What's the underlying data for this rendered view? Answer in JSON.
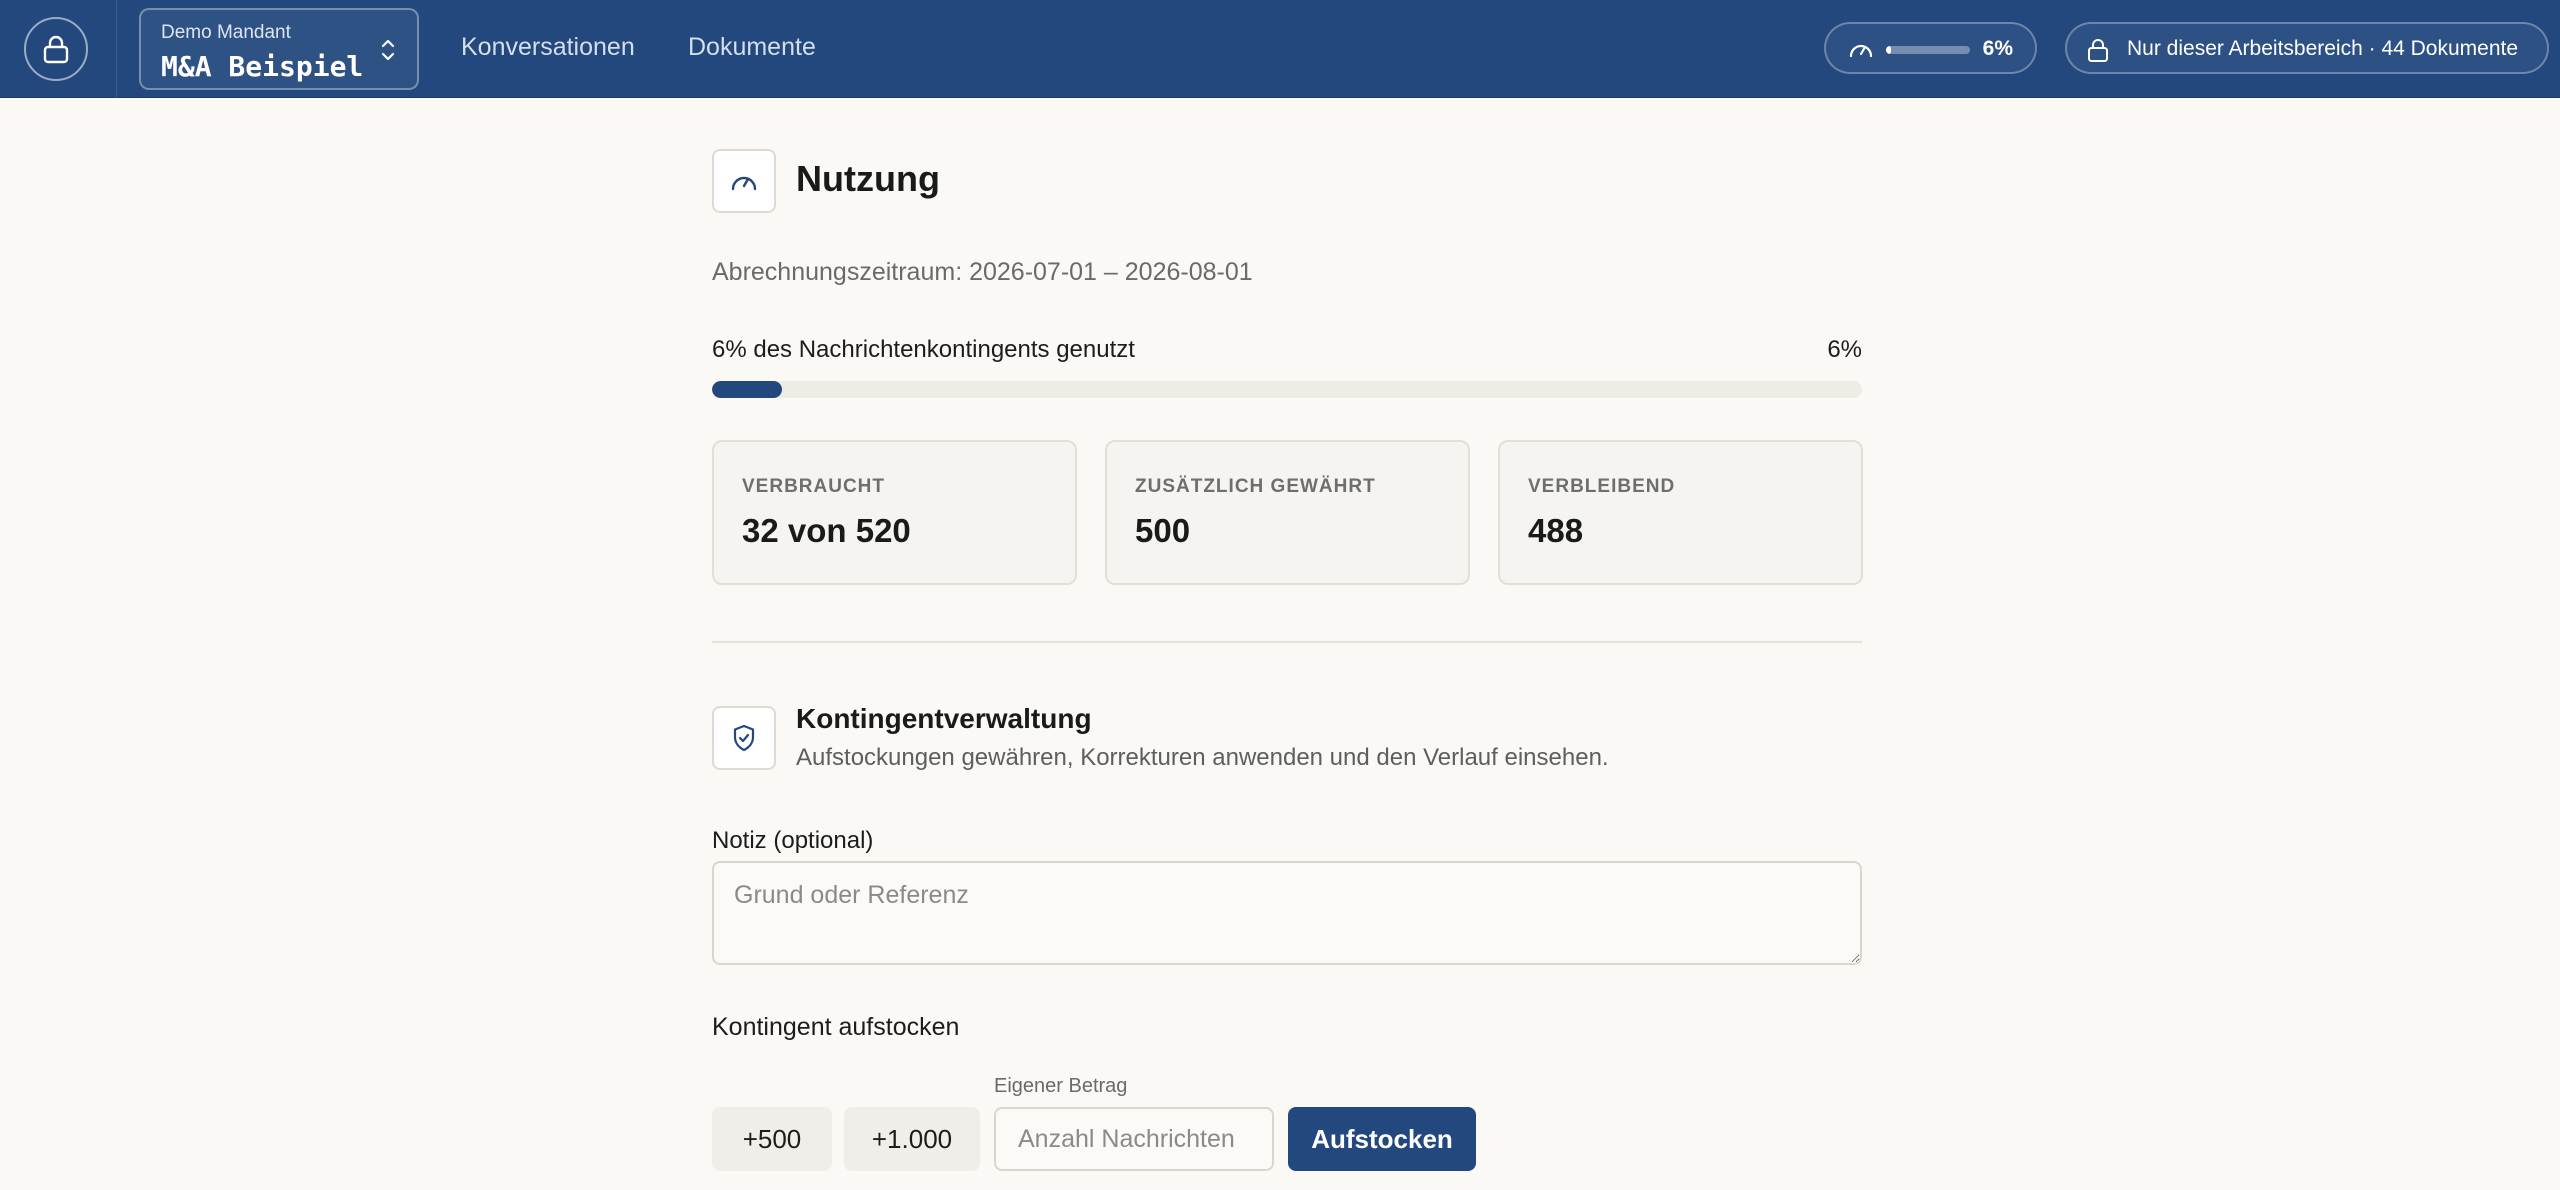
{
  "header": {
    "tenant_label": "Demo Mandant",
    "tenant_name": "M&A Beispiel",
    "nav": [
      "Konversationen",
      "Dokumente"
    ],
    "usage_percent_label": "6%",
    "usage_fraction": 0.06,
    "scope_text": "Nur dieser Arbeitsbereich · 44 Dokumente"
  },
  "usage": {
    "title": "Nutzung",
    "period": "Abrechnungszeitraum: 2026-07-01 – 2026-08-01",
    "quota_label": "6% des Nachrichtenkontingents genutzt",
    "quota_percent": "6%",
    "quota_fraction": 0.06,
    "stats": [
      {
        "label": "VERBRAUCHT",
        "value": "32 von 520"
      },
      {
        "label": "ZUSÄTZLICH GEWÄHRT",
        "value": "500"
      },
      {
        "label": "VERBLEIBEND",
        "value": "488"
      }
    ]
  },
  "management": {
    "title": "Kontingentverwaltung",
    "subtitle": "Aufstockungen gewähren, Korrekturen anwenden und den Verlauf einsehen.",
    "note_label": "Notiz (optional)",
    "note_placeholder": "Grund oder Referenz",
    "topup_label": "Kontingent aufstocken",
    "chips": [
      "+500",
      "+1.000"
    ],
    "custom_label": "Eigener Betrag",
    "custom_placeholder": "Anzahl Nachrichten",
    "submit_label": "Aufstocken"
  },
  "colors": {
    "brand": "#22487e",
    "background": "#faf9f6"
  }
}
